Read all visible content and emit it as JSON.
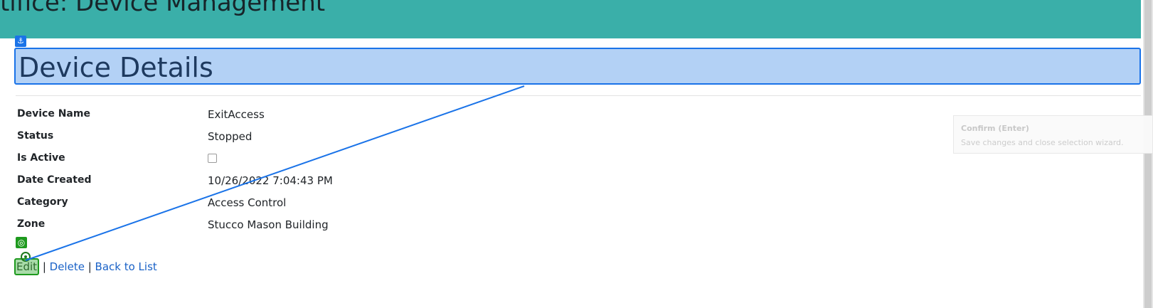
{
  "header": {
    "title": "rtifice: Device Management"
  },
  "page": {
    "heading": "Device Details"
  },
  "details": [
    {
      "label": "Device Name",
      "value": "ExitAccess"
    },
    {
      "label": "Status",
      "value": "Stopped"
    },
    {
      "label": "Is Active",
      "checked": false
    },
    {
      "label": "Date Created",
      "value": "10/26/2022 7:04:43 PM"
    },
    {
      "label": "Category",
      "value": "Access Control"
    },
    {
      "label": "Zone",
      "value": "Stucco Mason Building"
    }
  ],
  "actions": {
    "edit": "Edit",
    "delete": "Delete",
    "back": "Back to List",
    "separator": " | "
  },
  "overlay": {
    "anchor_icon": "anchor-icon",
    "target_icon": "target-icon",
    "confirm_title": "Confirm (Enter)",
    "confirm_subtitle": "Save changes and close selection wizard.",
    "highlight_color": "#1a73e8",
    "selected_color": "#1e9a1e"
  },
  "colors": {
    "header_bg": "#3aafa9",
    "link": "#1a62c7"
  }
}
